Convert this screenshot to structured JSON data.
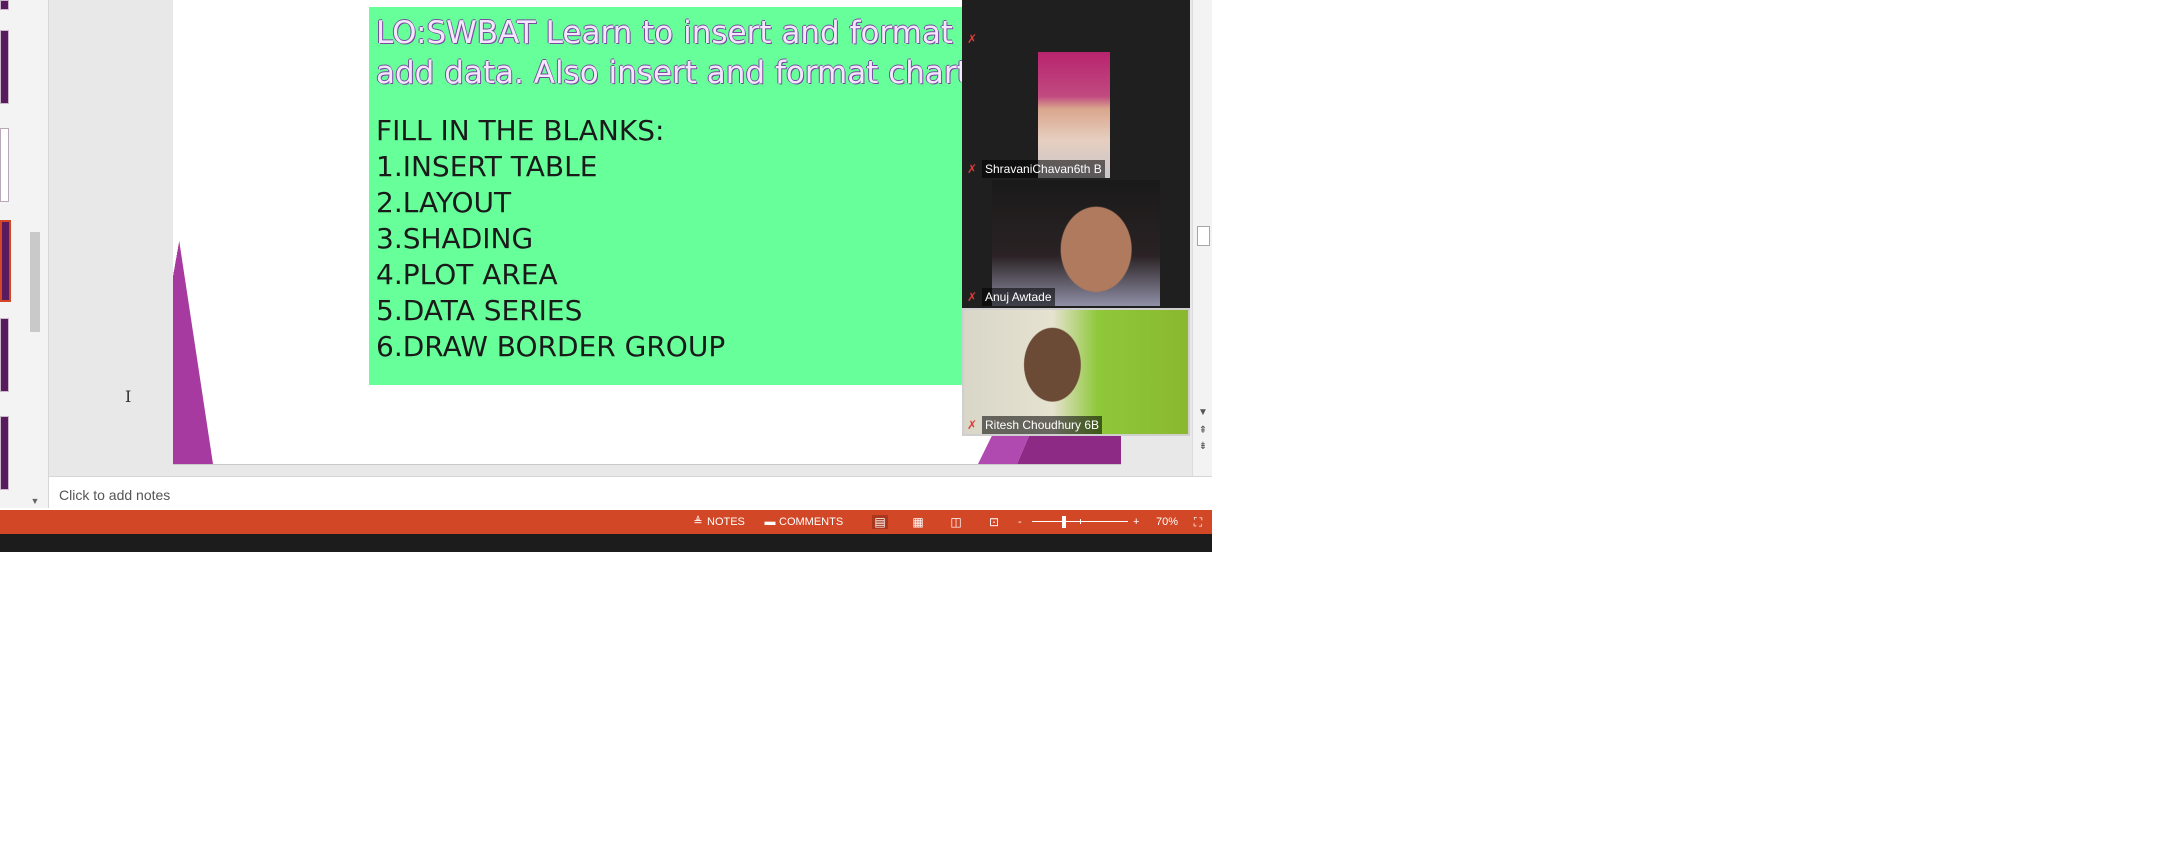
{
  "slide": {
    "lo_text": "LO:SWBAT Learn to insert and format table, add data. Also insert and format chart.",
    "fill_title": "FILL IN THE BLANKS:",
    "items": [
      {
        "num": "1.",
        "text": "INSERT TABLE"
      },
      {
        "num": "2.",
        "text": "LAYOUT"
      },
      {
        "num": "3.",
        "text": "SHADING"
      },
      {
        "num": "4.",
        "text": "PLOT AREA"
      },
      {
        "num": "5.",
        "text": "DATA SERIES"
      },
      {
        "num": "6.",
        "text": "DRAW BORDER GROUP"
      }
    ],
    "box_color": "#66ff99",
    "accent_color": "#8d2a86"
  },
  "participants": [
    {
      "name": "ShravaniChavan6th B",
      "muted": true
    },
    {
      "name": "Anuj Awtade",
      "muted": true
    },
    {
      "name": "Ritesh Choudhury 6B",
      "muted": true
    }
  ],
  "notes": {
    "placeholder": "Click to add notes"
  },
  "status_bar": {
    "notes_label": "NOTES",
    "comments_label": "COMMENTS",
    "zoom_label": "70%",
    "zoom_minus": "-",
    "zoom_plus": "+",
    "color": "#d24726"
  },
  "icons": {
    "mute": "mic-muted-icon",
    "notes": "notes-icon",
    "comments": "comments-icon",
    "normal_view": "normal-view-icon",
    "slide_sorter": "slide-sorter-icon",
    "reading_view": "reading-view-icon",
    "slideshow": "slideshow-icon",
    "fit": "fit-to-window-icon"
  }
}
